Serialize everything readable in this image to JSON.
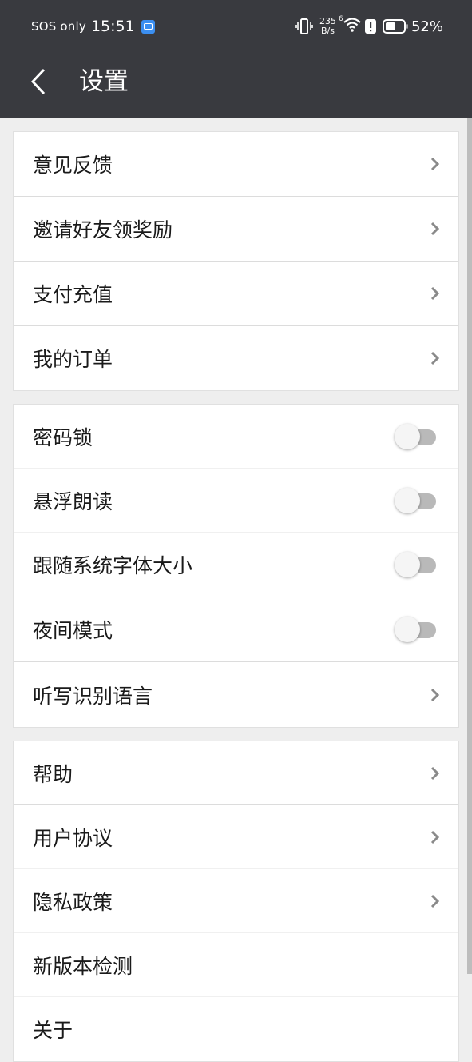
{
  "status_bar": {
    "carrier": "SOS only",
    "time": "15:51",
    "net_speed_value": "235",
    "net_speed_unit": "B/s",
    "wifi_label": "6",
    "battery": "52%"
  },
  "header": {
    "title": "设置"
  },
  "groups": [
    {
      "items": [
        {
          "label": "意见反馈",
          "type": "chevron"
        },
        {
          "label": "邀请好友领奖励",
          "type": "chevron"
        },
        {
          "label": "支付充值",
          "type": "chevron"
        },
        {
          "label": "我的订单",
          "type": "chevron"
        }
      ]
    },
    {
      "items": [
        {
          "label": "密码锁",
          "type": "toggle",
          "on": false
        },
        {
          "label": "悬浮朗读",
          "type": "toggle",
          "on": false
        },
        {
          "label": "跟随系统字体大小",
          "type": "toggle",
          "on": false
        },
        {
          "label": "夜间模式",
          "type": "toggle",
          "on": false
        },
        {
          "label": "听写识别语言",
          "type": "chevron"
        }
      ]
    },
    {
      "items": [
        {
          "label": "帮助",
          "type": "chevron"
        },
        {
          "label": "用户协议",
          "type": "chevron"
        },
        {
          "label": "隐私政策",
          "type": "chevron"
        },
        {
          "label": "新版本检测",
          "type": "none"
        },
        {
          "label": "关于",
          "type": "none"
        }
      ]
    }
  ],
  "colors": {
    "header_bg": "#393a3f",
    "page_bg": "#eeeeee",
    "toggle_off_track": "#b9b9b9"
  }
}
